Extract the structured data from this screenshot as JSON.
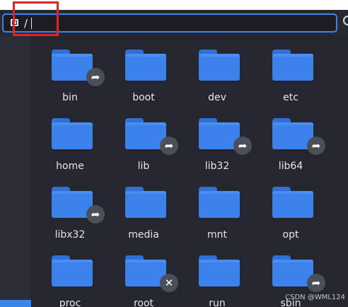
{
  "pathbar": {
    "path": "/",
    "location_icon": "drive-icon",
    "search_icon": "search-icon",
    "accent_color": "#3a86e8",
    "highlight_color": "#e52421"
  },
  "files": [
    {
      "name": "bin",
      "badge": "symlink"
    },
    {
      "name": "boot",
      "badge": ""
    },
    {
      "name": "dev",
      "badge": ""
    },
    {
      "name": "etc",
      "badge": ""
    },
    {
      "name": "home",
      "badge": ""
    },
    {
      "name": "lib",
      "badge": "symlink"
    },
    {
      "name": "lib32",
      "badge": "symlink"
    },
    {
      "name": "lib64",
      "badge": "symlink"
    },
    {
      "name": "libx32",
      "badge": "symlink"
    },
    {
      "name": "media",
      "badge": ""
    },
    {
      "name": "mnt",
      "badge": ""
    },
    {
      "name": "opt",
      "badge": ""
    },
    {
      "name": "proc",
      "badge": ""
    },
    {
      "name": "root",
      "badge": "no-access"
    },
    {
      "name": "run",
      "badge": ""
    },
    {
      "name": "sbin",
      "badge": "symlink"
    }
  ],
  "badges": {
    "symlink": "➦",
    "no-access": "✕"
  },
  "watermark": "CSDN @WML124"
}
